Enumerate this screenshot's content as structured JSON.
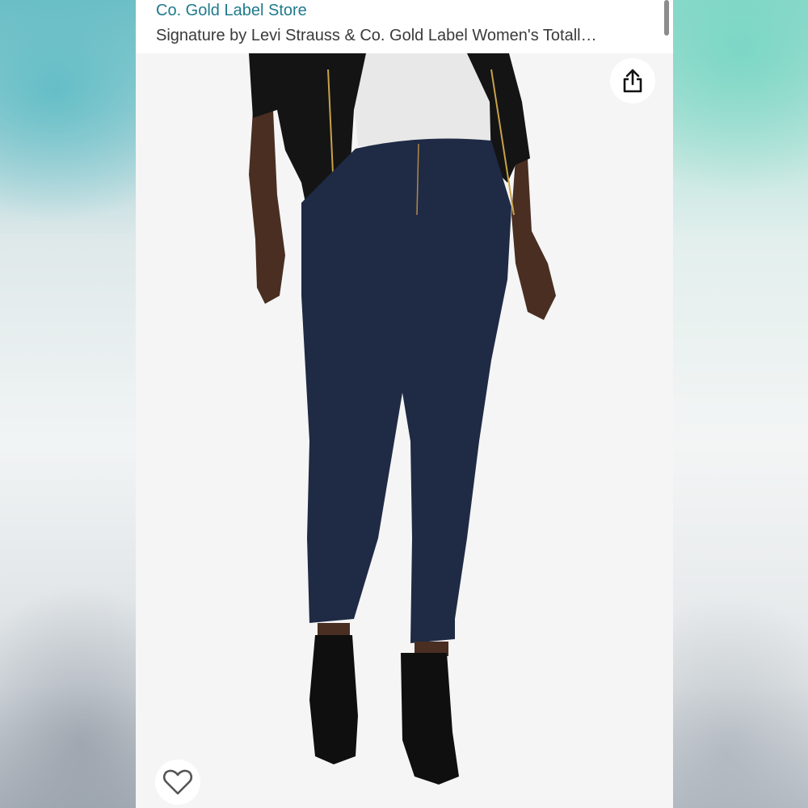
{
  "header": {
    "store_link": "Co. Gold Label Store",
    "product_title": "Signature by Levi Strauss & Co. Gold Label Women's Totall…"
  },
  "actions": {
    "share_icon": "share-icon",
    "wishlist_icon": "heart-icon"
  },
  "colors": {
    "link": "#1f7a8c",
    "title": "#3a3a3a",
    "denim": "#1f2a45",
    "jacket": "#141414"
  }
}
